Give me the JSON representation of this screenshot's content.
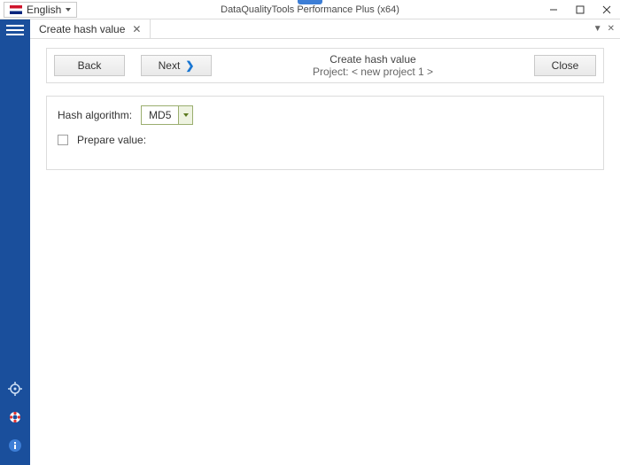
{
  "window": {
    "title": "DataQualityTools Performance Plus (x64)",
    "language": "English"
  },
  "tab": {
    "title": "Create hash value"
  },
  "wizard": {
    "back_label": "Back",
    "next_label": "Next",
    "close_label": "Close",
    "heading": "Create hash value",
    "subheading": "Project: < new project 1 >"
  },
  "form": {
    "hash_algorithm_label": "Hash algorithm:",
    "hash_algorithm_value": "MD5",
    "prepare_value_label": "Prepare value:"
  }
}
